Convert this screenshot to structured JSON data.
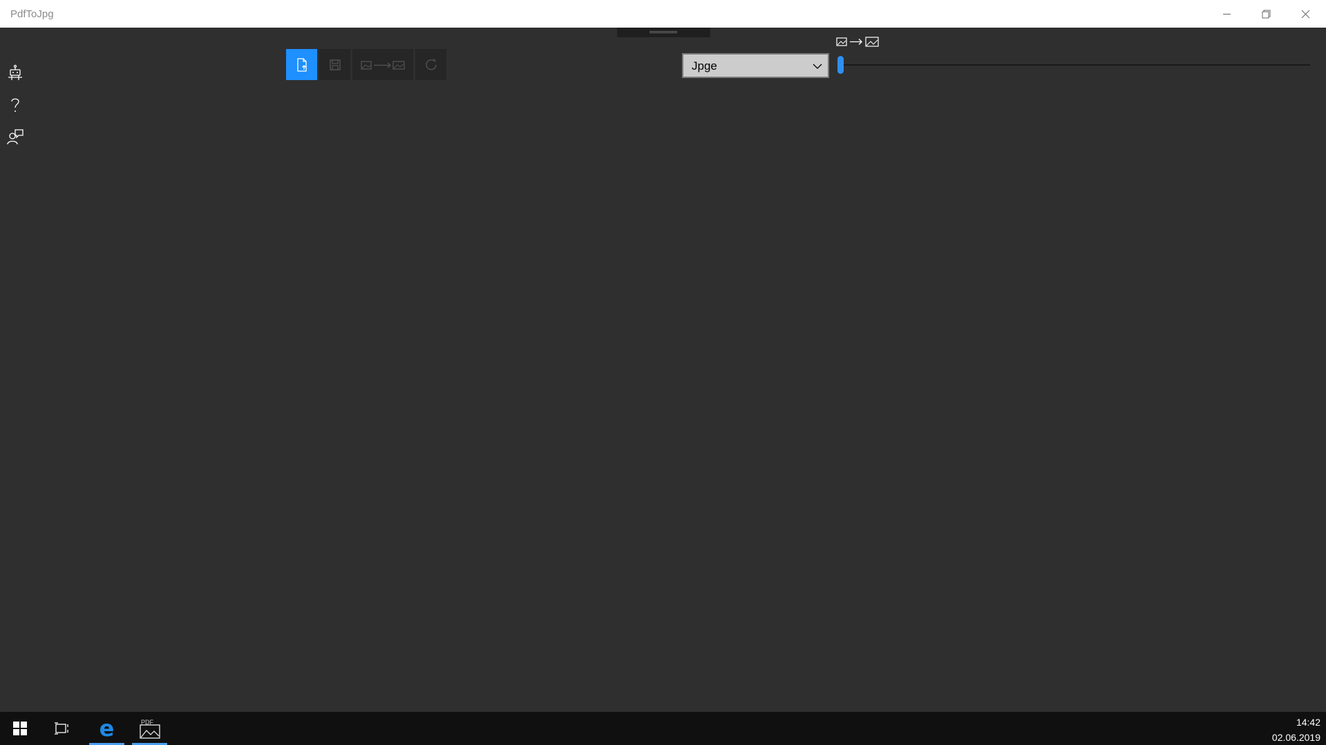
{
  "window": {
    "title": "PdfToJpg"
  },
  "rail": {
    "items": [
      {
        "icon": "robot-icon"
      },
      {
        "icon": "help-icon"
      },
      {
        "icon": "feedback-icon"
      }
    ]
  },
  "toolbar": {
    "buttons": [
      {
        "icon": "open-file-icon",
        "state": "active"
      },
      {
        "icon": "save-icon",
        "state": "disabled"
      },
      {
        "icon": "convert-icon",
        "state": "disabled"
      },
      {
        "icon": "refresh-icon",
        "state": "disabled"
      }
    ]
  },
  "format": {
    "selected": "Jpge"
  },
  "quality": {
    "value_fraction": 0.0
  },
  "taskbar": {
    "time": "14:42",
    "date": "02.06.2019",
    "pdf_label": "PDF"
  },
  "colors": {
    "accent": "#1e90ff",
    "background": "#2f2f2f",
    "taskbar": "#101010"
  }
}
